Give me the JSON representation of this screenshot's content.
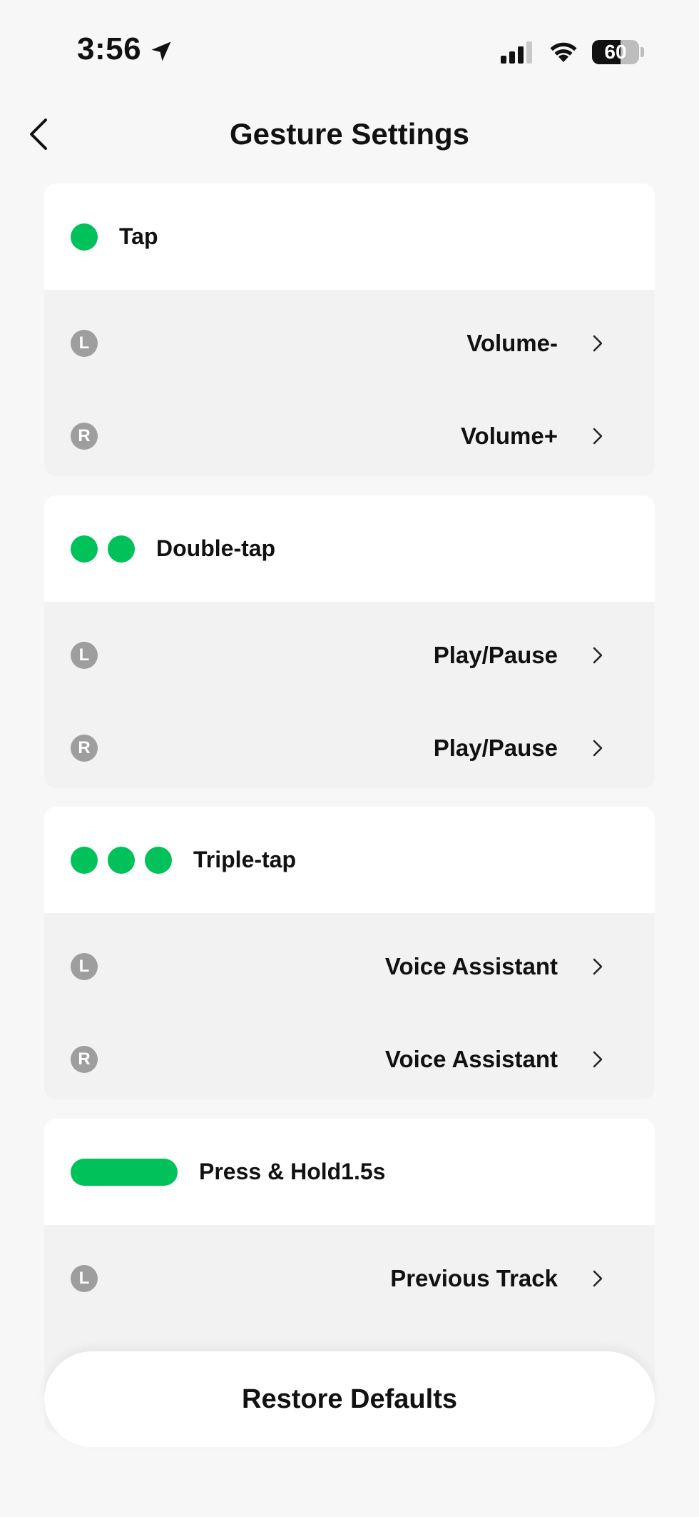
{
  "status_bar": {
    "time": "3:56",
    "battery_percent": 60,
    "battery_text": "60",
    "icons": [
      "location-arrow-icon",
      "cellular-signal-icon",
      "wifi-icon",
      "battery-icon"
    ]
  },
  "header": {
    "title": "Gesture Settings",
    "back_icon": "chevron-left-icon"
  },
  "accent_color": "#00c15a",
  "gestures": [
    {
      "label": "Tap",
      "indicator": "1 dot",
      "left": {
        "badge": "L",
        "value": "Volume-"
      },
      "right": {
        "badge": "R",
        "value": "Volume+"
      }
    },
    {
      "label": "Double-tap",
      "indicator": "2 dots",
      "left": {
        "badge": "L",
        "value": "Play/Pause"
      },
      "right": {
        "badge": "R",
        "value": "Play/Pause"
      }
    },
    {
      "label": "Triple-tap",
      "indicator": "3 dots",
      "left": {
        "badge": "L",
        "value": "Voice Assistant"
      },
      "right": {
        "badge": "R",
        "value": "Voice Assistant"
      }
    },
    {
      "label": "Press & Hold1.5s",
      "indicator": "pill",
      "left": {
        "badge": "L",
        "value": "Previous Track"
      }
    }
  ],
  "footer": {
    "restore_label": "Restore Defaults"
  }
}
